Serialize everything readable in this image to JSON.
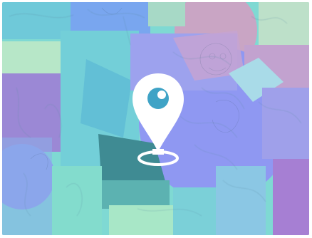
{
  "illustration": {
    "subject": "location-pin-over-collage",
    "icon": "location-pin-icon",
    "colors": {
      "pin": "#ffffff",
      "pin_dot": "#3fa3c6",
      "base_teal": "#78d6d2",
      "lavender": "#9a9ef0",
      "periwinkle": "#8d97f4",
      "purple": "#9686d8",
      "dark_teal": "#3f8a91",
      "mint": "#a8e6c3",
      "pink": "#d9a6c6"
    }
  }
}
